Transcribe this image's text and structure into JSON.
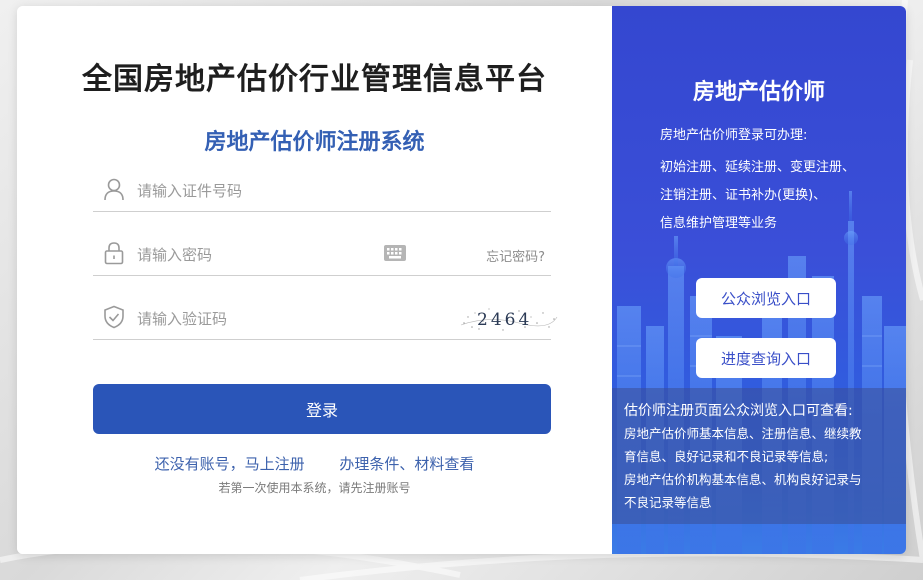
{
  "login": {
    "main_title": "全国房地产估价行业管理信息平台",
    "sub_title": "房地产估价师注册系统",
    "id_placeholder": "请输入证件号码",
    "password_placeholder": "请输入密码",
    "forgot_label": "忘记密码?",
    "captcha_placeholder": "请输入验证码",
    "captcha_text": "2464",
    "login_label": "登录",
    "register_link": "还没有账号，马上注册",
    "conditions_link": "办理条件、材料查看",
    "hint": "若第一次使用本系统，请先注册账号"
  },
  "side": {
    "title": "房地产估价师",
    "intro": "房地产估价师登录可办理:",
    "services": [
      "初始注册、延续注册、变更注册、",
      "注销注册、证书补办(更换)、",
      "信息维护管理等业务"
    ],
    "public_browse_label": "公众浏览入口",
    "progress_query_label": "进度查询入口",
    "info_title": "估价师注册页面公众浏览入口可查看:",
    "info_lines": [
      "房地产估价师基本信息、注册信息、继续教",
      "育信息、良好记录和不良记录等信息;",
      "房地产估价机构基本信息、机构良好记录与",
      "不良记录等信息"
    ]
  },
  "colors": {
    "title": "#1e1e1e",
    "accent": "#3460b4",
    "button": "#2a55b8",
    "side_bg": "#3447d0"
  },
  "icons": {
    "id_field": "user-icon",
    "password_field": "lock-icon",
    "keyboard": "keyboard-icon",
    "captcha_field": "shield-check-icon"
  }
}
